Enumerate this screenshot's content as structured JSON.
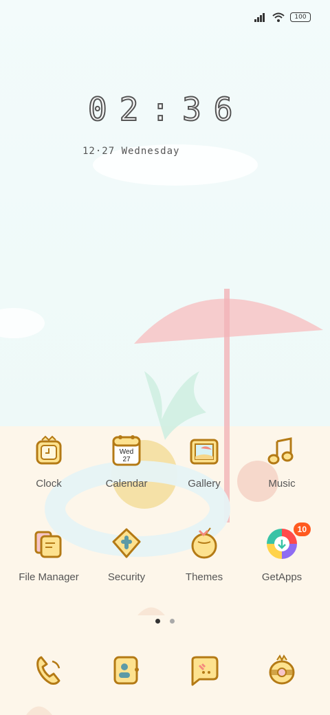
{
  "status": {
    "battery": "100"
  },
  "lockscreen": {
    "time": "02:36",
    "date": "12·27 Wednesday"
  },
  "apps": [
    {
      "name": "Clock"
    },
    {
      "name": "Calendar",
      "day": "Wed",
      "date": "27"
    },
    {
      "name": "Gallery"
    },
    {
      "name": "Music"
    },
    {
      "name": "File Manager"
    },
    {
      "name": "Security"
    },
    {
      "name": "Themes"
    },
    {
      "name": "GetApps",
      "badge": "10"
    }
  ],
  "dock": [
    {
      "icon": "phone-icon"
    },
    {
      "icon": "contacts-icon"
    },
    {
      "icon": "messages-icon"
    },
    {
      "icon": "camera-icon"
    }
  ],
  "page_indicator": {
    "current": 1,
    "total": 2
  }
}
